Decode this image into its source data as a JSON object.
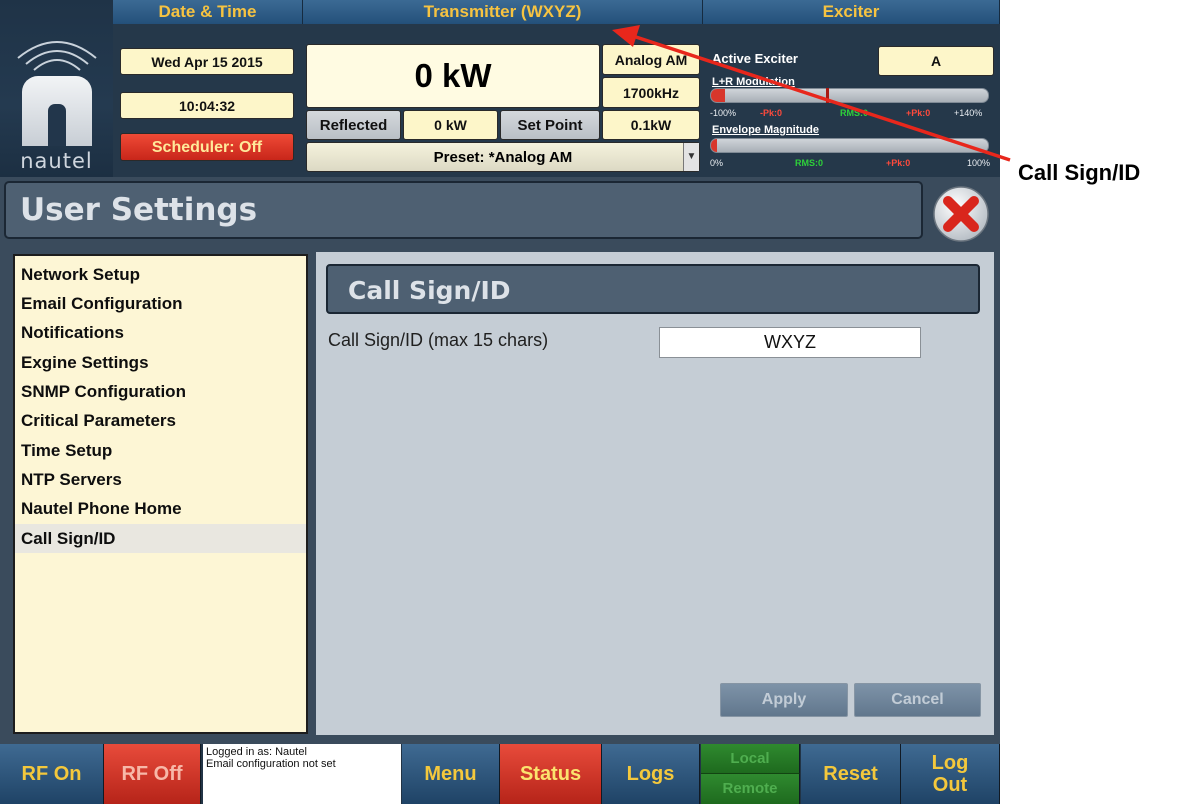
{
  "brand": {
    "logo_text": "nautel"
  },
  "header": {
    "date_time": {
      "title": "Date & Time",
      "date": "Wed Apr 15 2015",
      "time": "10:04:32",
      "scheduler": "Scheduler: Off"
    },
    "transmitter": {
      "title": "Transmitter (WXYZ)",
      "power": "0 kW",
      "mode": "Analog AM",
      "frequency": "1700kHz",
      "reflected_label": "Reflected",
      "reflected_value": "0 kW",
      "setpoint_label": "Set Point",
      "setpoint_value": "0.1kW",
      "preset": "Preset: *Analog AM"
    },
    "exciter": {
      "title": "Exciter",
      "active_label": "Active Exciter",
      "active_value": "A",
      "lr_modulation": {
        "title": "L+R Modulation",
        "scale_min": "-100%",
        "neg_peak": "-Pk:0",
        "rms": "RMS:0",
        "pos_peak": "+Pk:0",
        "scale_max": "+140%",
        "level": 0.05
      },
      "envelope": {
        "title": "Envelope Magnitude",
        "scale_min": "0%",
        "rms": "RMS:0",
        "pos_peak": "+Pk:0",
        "scale_max": "100%",
        "level": 0.02
      }
    }
  },
  "page": {
    "title": "User Settings"
  },
  "menu": {
    "items": [
      {
        "label": "Network Setup",
        "selected": false
      },
      {
        "label": "Email Configuration",
        "selected": false
      },
      {
        "label": "Notifications",
        "selected": false
      },
      {
        "label": "Exgine Settings",
        "selected": false
      },
      {
        "label": "SNMP Configuration",
        "selected": false
      },
      {
        "label": "Critical Parameters",
        "selected": false
      },
      {
        "label": "Time Setup",
        "selected": false
      },
      {
        "label": "NTP Servers",
        "selected": false
      },
      {
        "label": "Nautel Phone Home",
        "selected": false
      },
      {
        "label": "Call Sign/ID",
        "selected": true
      }
    ]
  },
  "content": {
    "title": "Call Sign/ID",
    "field_label": "Call Sign/ID (max 15 chars)",
    "field_value": "WXYZ",
    "apply_label": "Apply",
    "cancel_label": "Cancel"
  },
  "bottom_bar": {
    "rf_on": "RF On",
    "rf_off": "RF Off",
    "message_line1": "Logged in as: Nautel",
    "message_line2": "Email configuration not set",
    "menu": "Menu",
    "status": "Status",
    "logs": "Logs",
    "local": "Local",
    "remote": "Remote",
    "reset": "Reset",
    "logout_line1": "Log",
    "logout_line2": "Out"
  },
  "annotation": {
    "label": "Call Sign/ID"
  },
  "colors": {
    "accent_gold": "#f6c341",
    "alarm_red": "#d8362b",
    "panel_blue": "#24507a",
    "menu_cream": "#fdf6d5",
    "local_remote_green": "#2f8a2f"
  }
}
